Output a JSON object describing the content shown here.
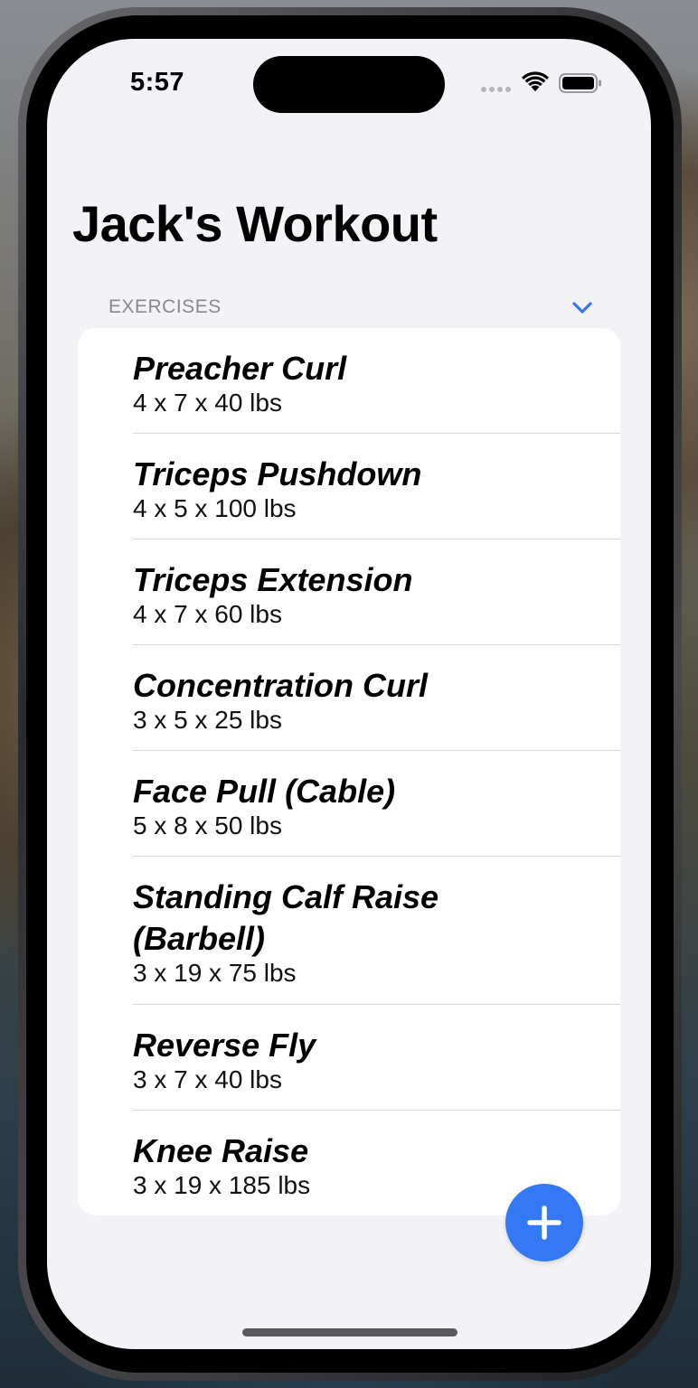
{
  "status_bar": {
    "time": "5:57"
  },
  "page": {
    "title": "Jack's Workout",
    "section_header": "EXERCISES"
  },
  "exercises": [
    {
      "name": "Preacher Curl",
      "detail": "4 x 7 x 40 lbs"
    },
    {
      "name": "Triceps Pushdown",
      "detail": "4 x 5 x 100 lbs"
    },
    {
      "name": "Triceps Extension",
      "detail": "4 x 7 x 60 lbs"
    },
    {
      "name": "Concentration Curl",
      "detail": "3 x 5 x 25 lbs"
    },
    {
      "name": "Face Pull (Cable)",
      "detail": "5 x 8 x 50 lbs"
    },
    {
      "name": "Standing Calf Raise (Barbell)",
      "detail": "3 x 19 x 75 lbs"
    },
    {
      "name": "Reverse Fly",
      "detail": "3 x 7 x 40 lbs"
    },
    {
      "name": "Knee Raise",
      "detail": "3 x 19 x 185 lbs"
    }
  ],
  "icons": {
    "collapse": "chevron-down-icon",
    "add": "plus-icon",
    "wifi": "wifi-icon",
    "battery": "battery-icon",
    "signal": "cellular-signal-icon"
  },
  "colors": {
    "accent": "#3478f6",
    "background": "#f2f2f7",
    "card": "#ffffff",
    "section_header": "#8a8a8e"
  }
}
